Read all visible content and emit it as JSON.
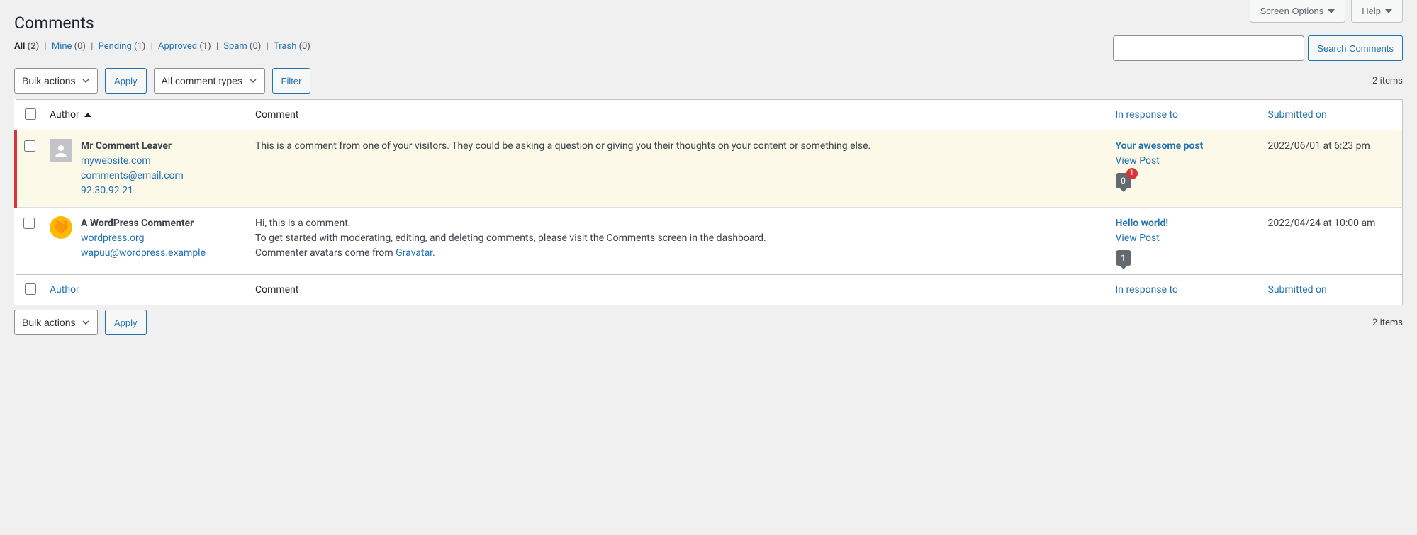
{
  "top": {
    "screen_options": "Screen Options",
    "help": "Help"
  },
  "page_title": "Comments",
  "filters": {
    "all": {
      "label": "All",
      "count": "(2)"
    },
    "mine": {
      "label": "Mine",
      "count": "(0)"
    },
    "pending": {
      "label": "Pending",
      "count": "(1)"
    },
    "approved": {
      "label": "Approved",
      "count": "(1)"
    },
    "spam": {
      "label": "Spam",
      "count": "(0)"
    },
    "trash": {
      "label": "Trash",
      "count": "(0)"
    }
  },
  "search": {
    "button": "Search Comments"
  },
  "bulk": {
    "select": "Bulk actions",
    "apply": "Apply"
  },
  "types": {
    "select": "All comment types",
    "filter": "Filter"
  },
  "pagination": {
    "text": "2 items"
  },
  "columns": {
    "author": "Author",
    "comment": "Comment",
    "response": "In response to",
    "date": "Submitted on"
  },
  "rows": [
    {
      "status": "unapproved",
      "author_name": "Mr Comment Leaver",
      "author_url": "mywebsite.com",
      "author_email": "comments@email.com",
      "author_ip": "92.30.92.21",
      "avatar_type": "default",
      "body_plain": "This is a comment from one of your visitors. They could be asking a question or giving you their thoughts on your content or something else.",
      "post_title": "Your awesome post",
      "view_post": "View Post",
      "bubble_count": "0",
      "pending_badge": "1",
      "date": "2022/06/01 at 6:23 pm"
    },
    {
      "status": "approved",
      "author_name": "A WordPress Commenter",
      "author_url": "wordpress.org",
      "author_email": "wapuu@wordpress.example",
      "author_ip": "",
      "avatar_type": "wapuu",
      "body_line1": "Hi, this is a comment.",
      "body_line2": "To get started with moderating, editing, and deleting comments, please visit the Comments screen in the dashboard.",
      "body_line3_pre": "Commenter avatars come from ",
      "body_line3_link": "Gravatar",
      "body_line3_post": ".",
      "post_title": "Hello world!",
      "view_post": "View Post",
      "bubble_count": "1",
      "pending_badge": "",
      "date": "2022/04/24 at 10:00 am"
    }
  ]
}
